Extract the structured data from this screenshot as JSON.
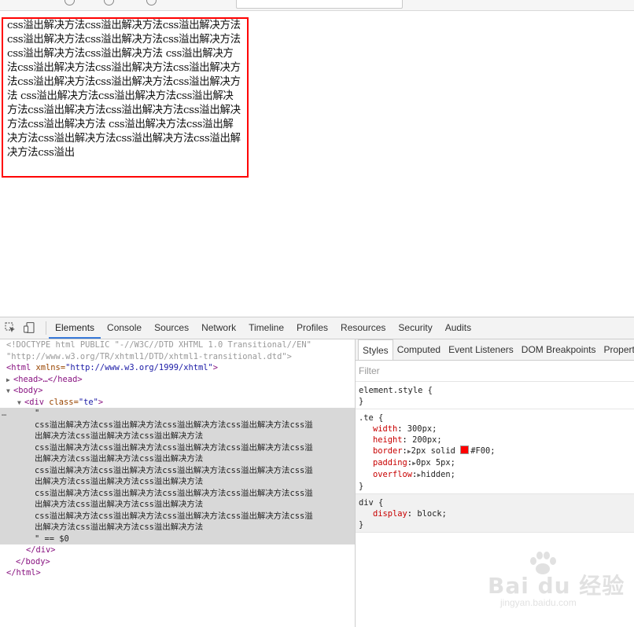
{
  "demo": {
    "text": "css溢出解决方法css溢出解决方法css溢出解决方法css溢出解决方法css溢出解决方法css溢出解决方法css溢出解决方法css溢出解决方法 css溢出解决方法css溢出解决方法css溢出解决方法css溢出解决方法css溢出解决方法css溢出解决方法css溢出解决方法 css溢出解决方法css溢出解决方法css溢出解决方法css溢出解决方法css溢出解决方法css溢出解决方法css溢出解决方法 css溢出解决方法css溢出解决方法css溢出解决方法css溢出解决方法css溢出解决方法css溢出"
  },
  "devtools": {
    "tabs": [
      "Elements",
      "Console",
      "Sources",
      "Network",
      "Timeline",
      "Profiles",
      "Resources",
      "Security",
      "Audits"
    ],
    "active_tab": "Elements",
    "icons": [
      "inspect-icon",
      "device-mode-icon"
    ],
    "elements": {
      "doctype1": "<!DOCTYPE html PUBLIC \"-//W3C//DTD XHTML 1.0 Transitional//EN\"",
      "doctype2": "\"http://www.w3.org/TR/xhtml1/DTD/xhtml1-transitional.dtd\">",
      "html_open_tag": "<html",
      "html_attr": " xmlns=",
      "html_attr_val": "\"http://www.w3.org/1999/xhtml\"",
      "html_close_bracket": ">",
      "head": "<head>…</head>",
      "body_open": "<body>",
      "div_open_tag": "<div",
      "div_attr": " class=",
      "div_attr_val": "\"te\"",
      "div_close_bracket": ">",
      "quote_open": "\"",
      "text_lines": [
        "css溢出解决方法css溢出解决方法css溢出解决方法css溢出解决方法css溢",
        "出解决方法css溢出解决方法css溢出解决方法",
        "css溢出解决方法css溢出解决方法css溢出解决方法css溢出解决方法css溢",
        "出解决方法css溢出解决方法css溢出解决方法",
        "css溢出解决方法css溢出解决方法css溢出解决方法css溢出解决方法css溢",
        "出解决方法css溢出解决方法css溢出解决方法",
        "css溢出解决方法css溢出解决方法css溢出解决方法css溢出解决方法css溢",
        "出解决方法css溢出解决方法css溢出解决方法",
        "css溢出解决方法css溢出解决方法css溢出解决方法css溢出解决方法css溢",
        "出解决方法css溢出解决方法css溢出解决方法"
      ],
      "quote_close": "\" == $0",
      "div_close": "</div>",
      "body_close": "</body>",
      "html_close": "</html>",
      "ellipsis": "…"
    },
    "styles": {
      "tabs": [
        "Styles",
        "Computed",
        "Event Listeners",
        "DOM Breakpoints",
        "Properti"
      ],
      "active_tab": "Styles",
      "filter_placeholder": "Filter",
      "element_style": "element.style {",
      "close_brace": "}",
      "te_selector": ".te {",
      "te_props": [
        {
          "name": "width",
          "value": "300px;"
        },
        {
          "name": "height",
          "value": "200px;"
        },
        {
          "name": "border",
          "value": "2px solid",
          "color": "#F00",
          "color_text": "#F00;"
        },
        {
          "name": "padding",
          "value": "0px 5px;"
        },
        {
          "name": "overflow",
          "value": "hidden;"
        }
      ],
      "div_selector": "div {",
      "div_props": [
        {
          "name": "display",
          "value": "block;"
        }
      ]
    }
  },
  "watermark": {
    "brand": "Bai du 经验",
    "url": "jingyan.baidu.com"
  }
}
